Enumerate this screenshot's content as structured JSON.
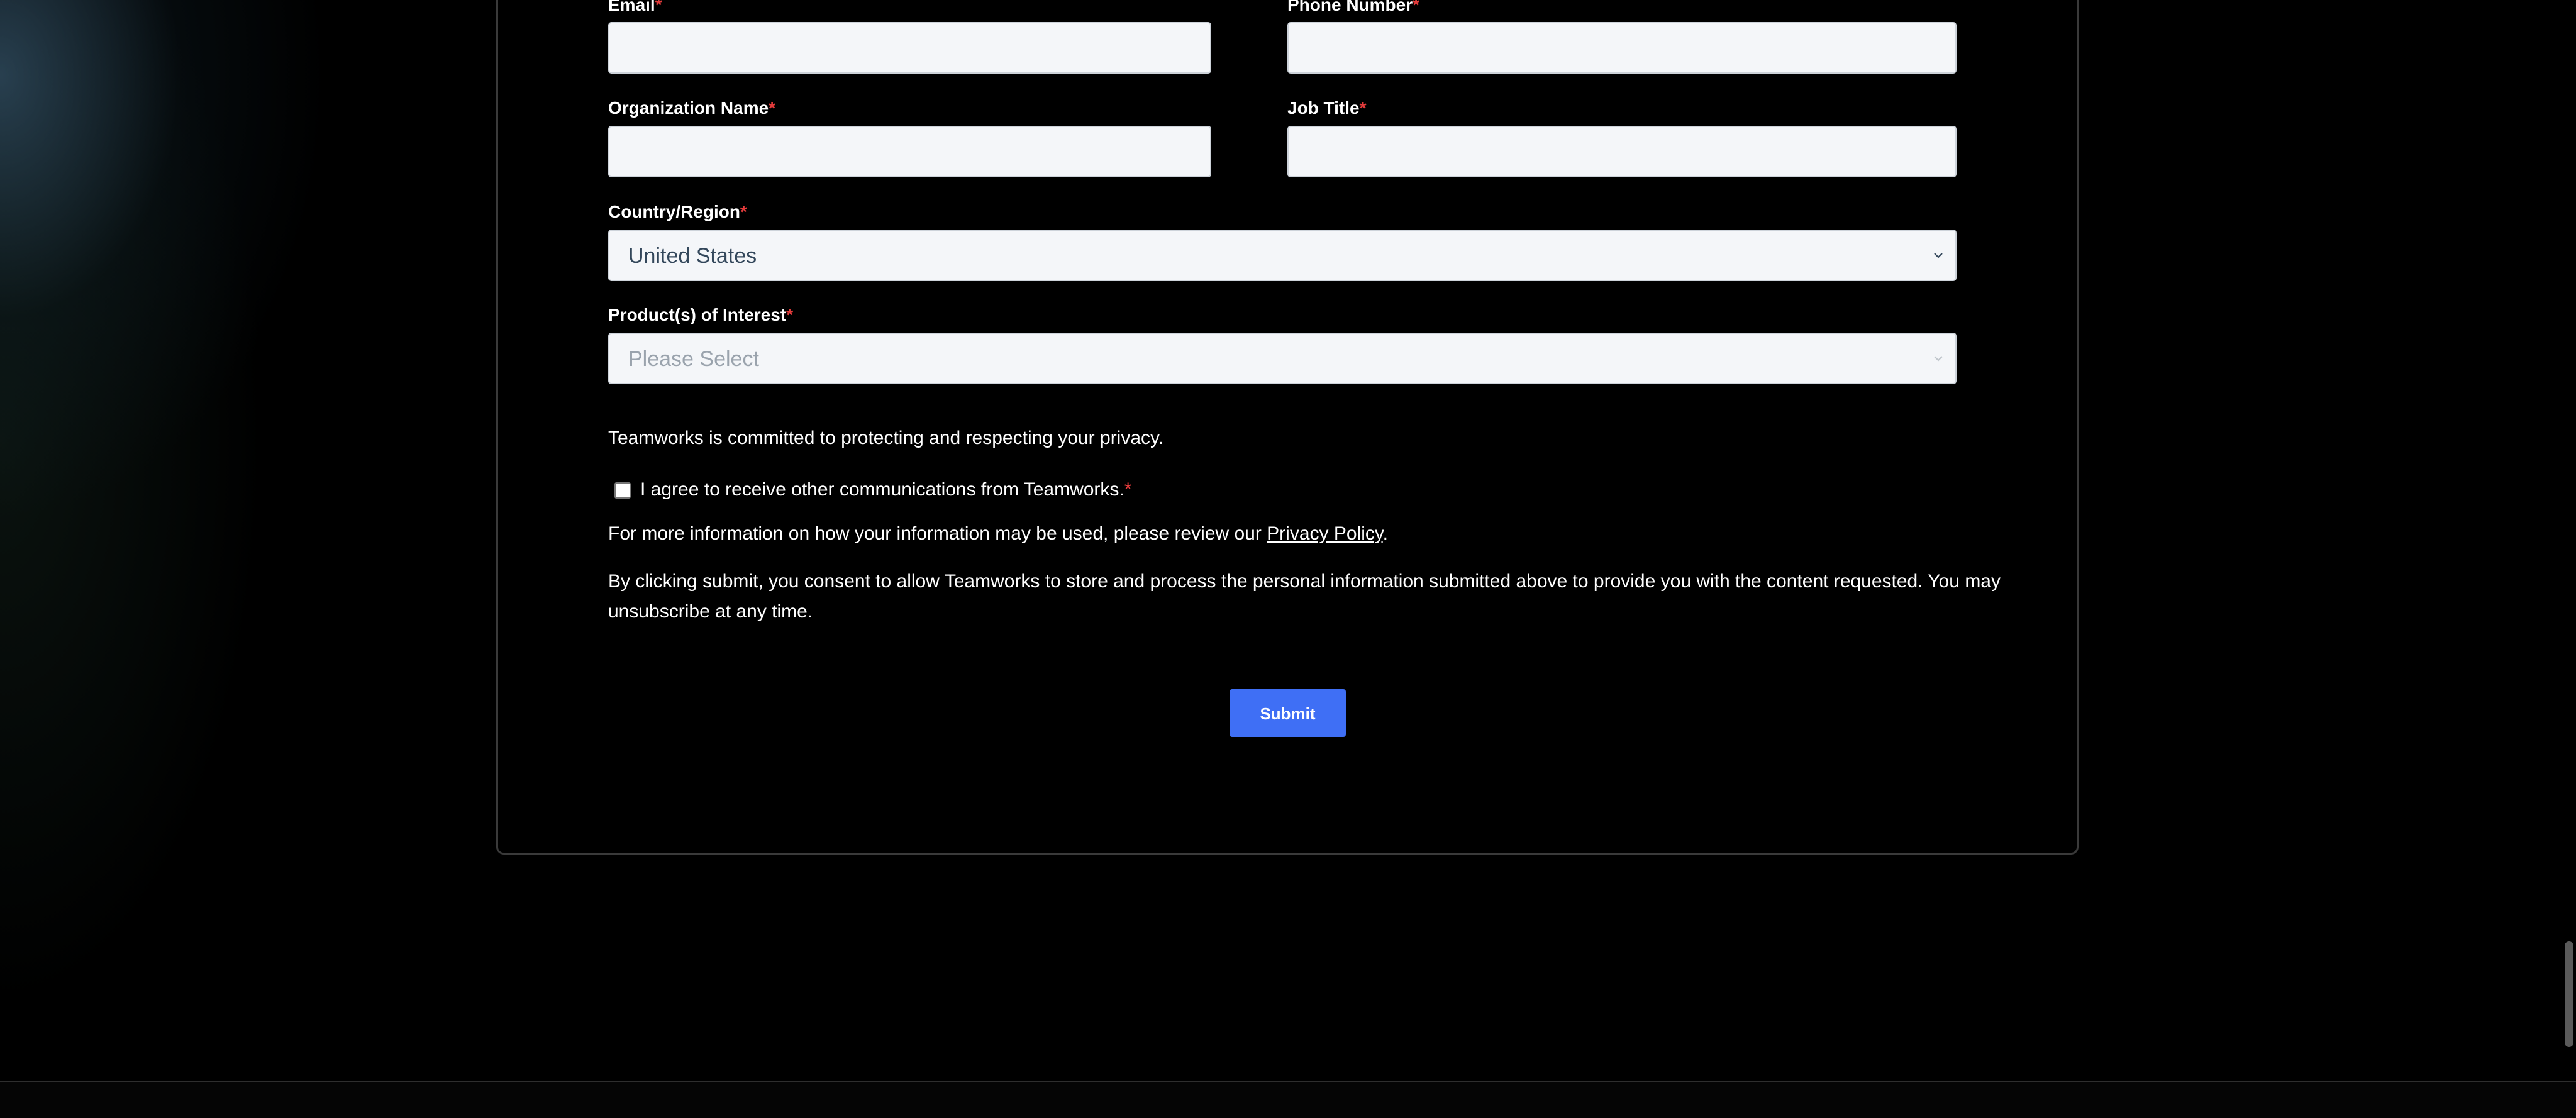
{
  "form": {
    "email_label": "Email",
    "phone_label": "Phone Number",
    "org_label": "Organization Name",
    "job_label": "Job Title",
    "country_label": "Country/Region",
    "country_value": "United States",
    "product_label": "Product(s) of Interest",
    "product_placeholder": "Please Select",
    "required_marker": "*",
    "privacy_commitment": "Teamworks is committed to protecting and respecting your privacy.",
    "consent_checkbox_label": "I agree to receive other communications from Teamworks.",
    "more_info_prefix": "For more information on how your information may be used, please review our ",
    "privacy_link_text": "Privacy Policy",
    "more_info_suffix": ".",
    "consent_line1": "By clicking submit, you consent to allow Teamworks to store and process the personal information submitted above to provide you with the content requested. You may",
    "consent_line2": "unsubscribe at any time.",
    "submit_label": "Submit",
    "consent_checked": false
  },
  "colors": {
    "submit_button": "#3f6ff5",
    "required_marker": "#e23b3b",
    "input_background": "#f4f6f9",
    "page_background": "#000000"
  },
  "icons": {
    "select_arrow": "chevron-down-icon"
  }
}
